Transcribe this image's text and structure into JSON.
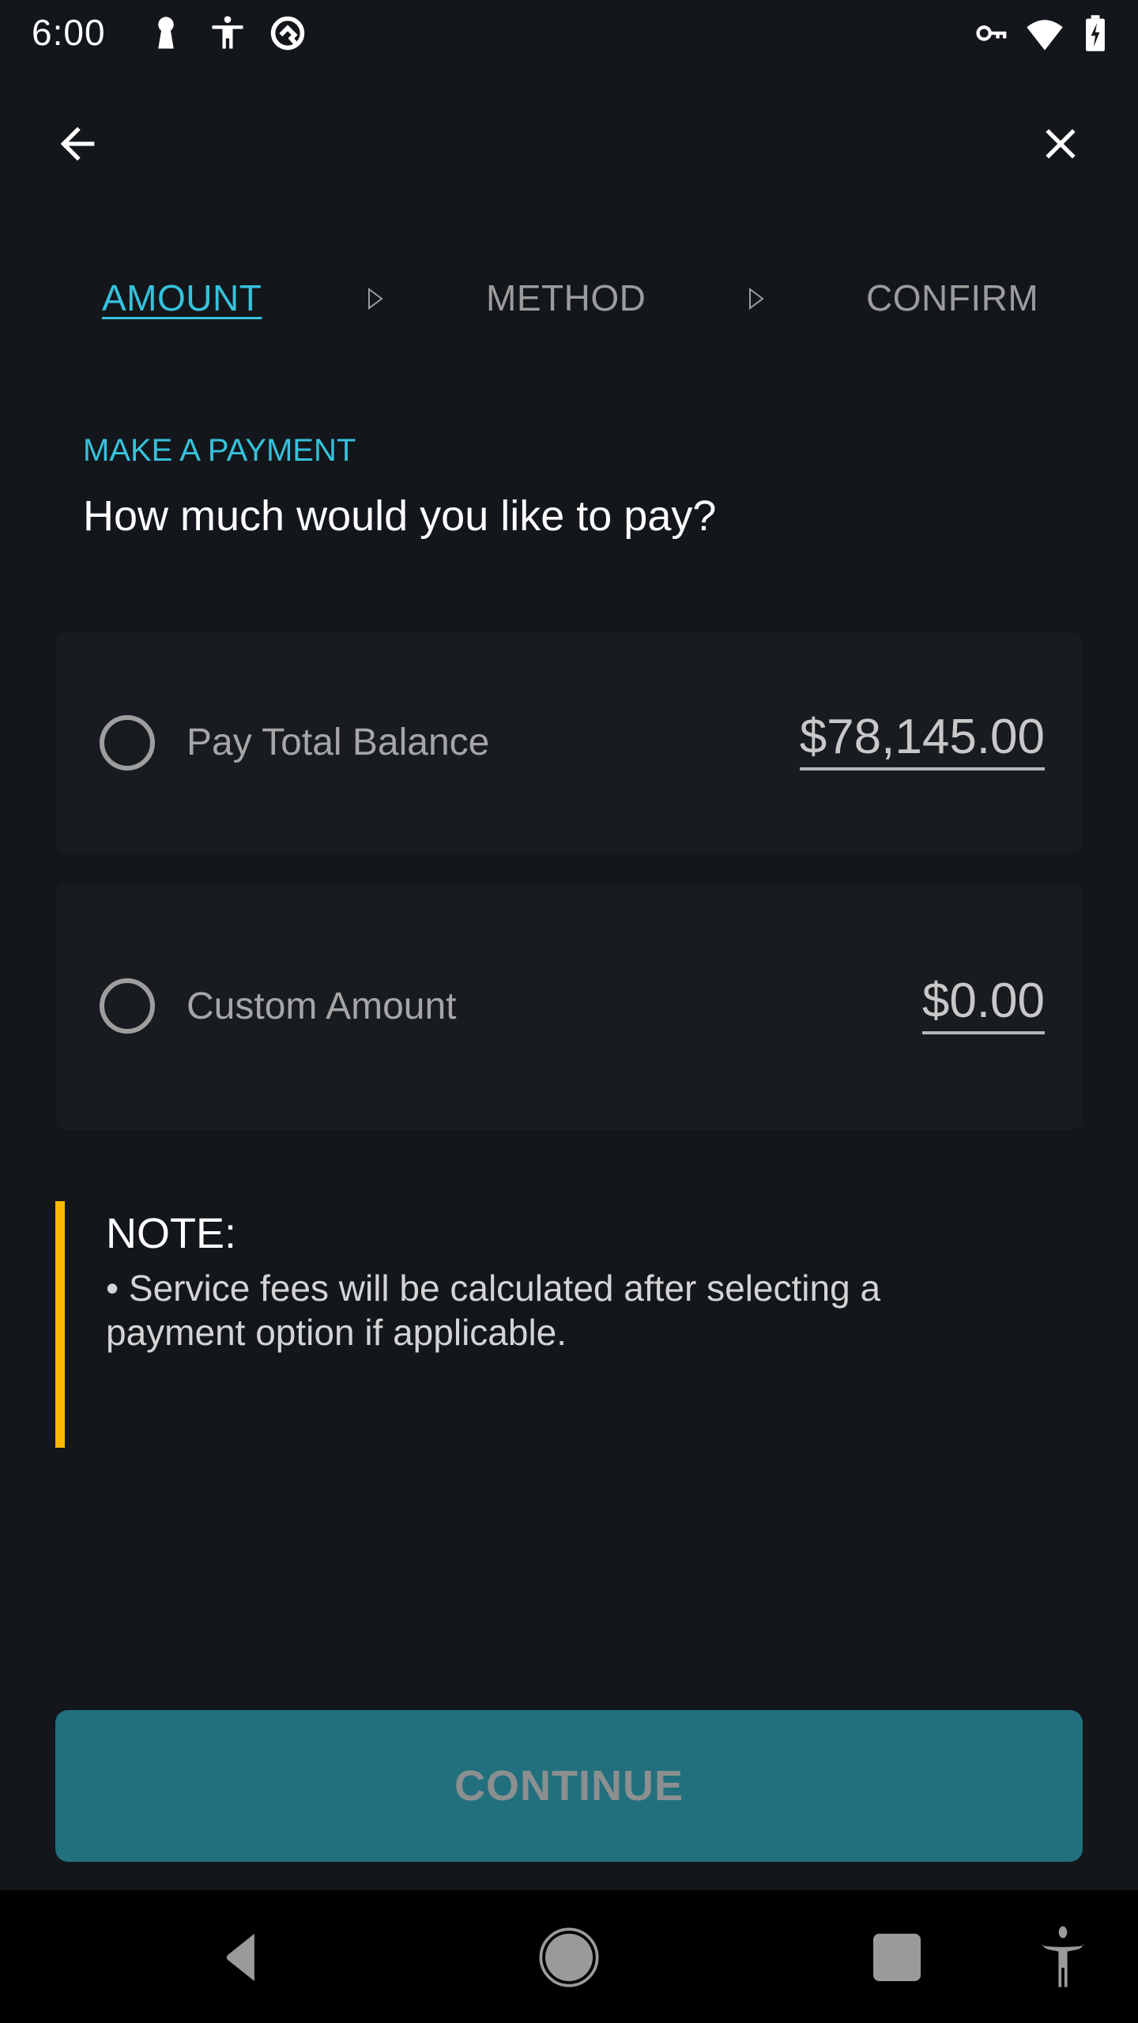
{
  "status_bar": {
    "time": "6:00",
    "left_icons": [
      "keyhole-icon",
      "accessibility-icon",
      "android-q-icon"
    ],
    "right_icons": [
      "vpn-key-icon",
      "wifi-icon",
      "battery-charging-icon"
    ]
  },
  "app_bar": {
    "back_icon": "arrow-left-icon",
    "close_icon": "close-icon"
  },
  "stepper": {
    "steps": [
      {
        "label": "AMOUNT",
        "active": true
      },
      {
        "label": "METHOD",
        "active": false
      },
      {
        "label": "CONFIRM",
        "active": false
      }
    ],
    "separator_icon": "triangle-right-outline-icon"
  },
  "header": {
    "eyebrow": "MAKE A PAYMENT",
    "question": "How much would you like to pay?"
  },
  "options": [
    {
      "label": "Pay Total Balance",
      "amount": "$78,145.00",
      "selected": false
    },
    {
      "label": "Custom Amount",
      "amount": "$0.00",
      "selected": false
    }
  ],
  "note": {
    "title": "NOTE:",
    "body": "• Service fees will be calculated after selecting a payment option if applicable."
  },
  "continue_button": {
    "label": "CONTINUE",
    "enabled": false
  },
  "nav_bar": {
    "icons": [
      "nav-back-icon",
      "nav-home-icon",
      "nav-recents-icon",
      "nav-accessibility-icon"
    ]
  },
  "colors": {
    "background": "#13171b",
    "accent": "#36c2dc",
    "card": "#181c20",
    "note_bar": "#fbb800",
    "button": "#22707d"
  }
}
